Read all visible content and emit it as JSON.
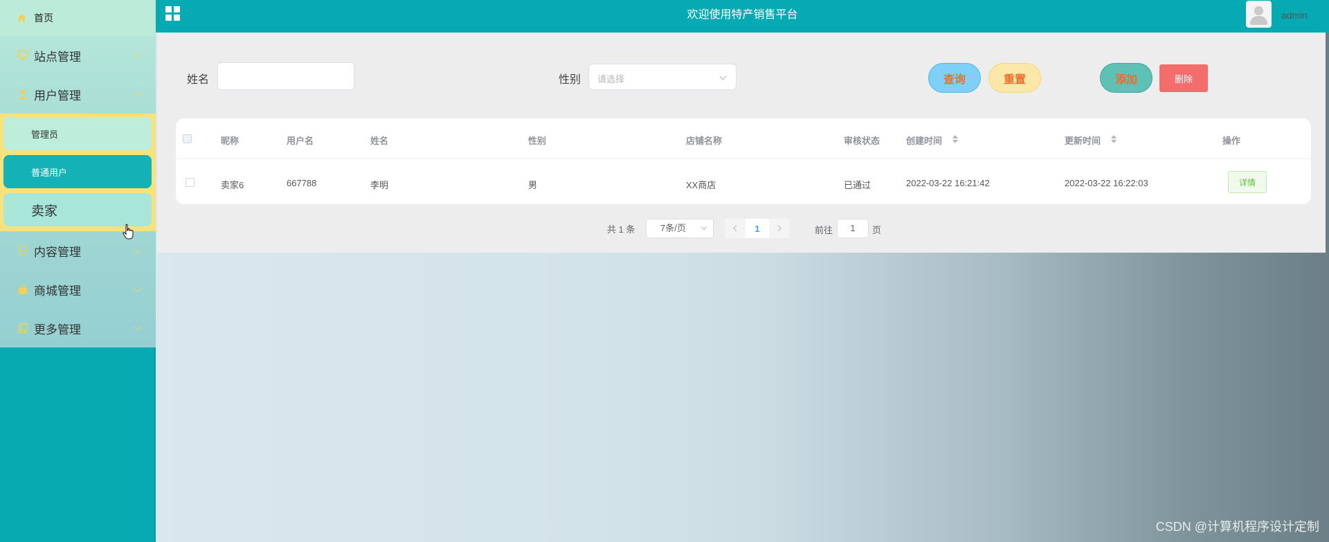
{
  "header": {
    "title": "欢迎使用特产销售平台",
    "username": "admin"
  },
  "sidebar": {
    "home": "首页",
    "items": [
      {
        "label": "站点管理",
        "icon": "monitor-icon",
        "expanded": false
      },
      {
        "label": "用户管理",
        "icon": "user-icon",
        "expanded": true
      },
      {
        "label": "内容管理",
        "icon": "chat-icon",
        "expanded": false
      },
      {
        "label": "商城管理",
        "icon": "bag-icon",
        "expanded": false
      },
      {
        "label": "更多管理",
        "icon": "copy-icon",
        "expanded": false
      }
    ],
    "user_submenu": [
      "管理员",
      "普通用户",
      "卖家"
    ],
    "active_submenu": "普通用户"
  },
  "search": {
    "name_label": "姓名",
    "name_value": "",
    "gender_label": "性别",
    "gender_placeholder": "请选择"
  },
  "buttons": {
    "query": "查询",
    "reset": "重置",
    "add": "添加",
    "delete": "删除"
  },
  "table": {
    "columns": [
      "昵称",
      "用户名",
      "姓名",
      "性别",
      "店铺名称",
      "审核状态",
      "创建时间",
      "更新时间",
      "操作"
    ],
    "rows": [
      {
        "nickname": "卖家6",
        "username": "667788",
        "name": "李明",
        "gender": "男",
        "shop": "XX商店",
        "status": "已通过",
        "created": "2022-03-22 16:21:42",
        "updated": "2022-03-22 16:22:03",
        "action": "详情"
      }
    ]
  },
  "pagination": {
    "total": "共 1 条",
    "page_size": "7条/页",
    "current": "1",
    "goto_prefix": "前往",
    "goto_value": "1",
    "goto_suffix": "页"
  },
  "watermark": "CSDN @计算机程序设计定制",
  "colors": {
    "accent": "#06aab3",
    "submenu_bg": "#f9e27a",
    "active_item": "#14b1b6",
    "delete": "#f46d6d"
  }
}
